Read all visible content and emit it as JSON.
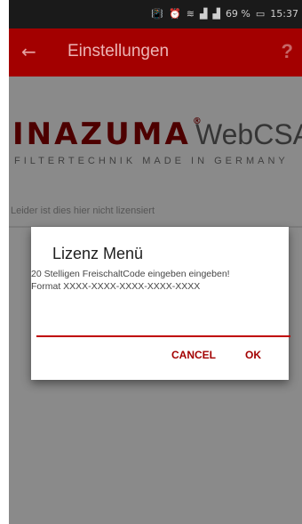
{
  "statusbar": {
    "icons": [
      "vibrate-icon",
      "alarm-icon",
      "wifi-icon",
      "signal-icon",
      "signal-icon"
    ],
    "battery": "69 %",
    "time": "15:37",
    "glyphs": {
      "vibrate": "📳",
      "alarm": "⏰",
      "wifi": "≋",
      "signal_a": "▟",
      "signal_b": "▟",
      "battery_icon": "▭"
    }
  },
  "appbar": {
    "back_icon": "←",
    "title": "Einstellungen",
    "help_icon": "?",
    "color": "#a30000"
  },
  "logo": {
    "brand": "INAZUMA",
    "reg": "®",
    "product": "WebCSA",
    "tagline": "FILTERTECHNIK MADE IN GERMANY"
  },
  "content": {
    "notice": "Leider ist dies hier nicht lizensiert"
  },
  "dialog": {
    "title": "Lizenz Menü",
    "message_line1": "20 Stelligen FreischaltCode eingeben eingeben!",
    "message_line2": "Format XXXX-XXXX-XXXX-XXXX-XXXX",
    "input_value": "",
    "cancel_label": "CANCEL",
    "ok_label": "OK",
    "accent": "#c00000"
  }
}
